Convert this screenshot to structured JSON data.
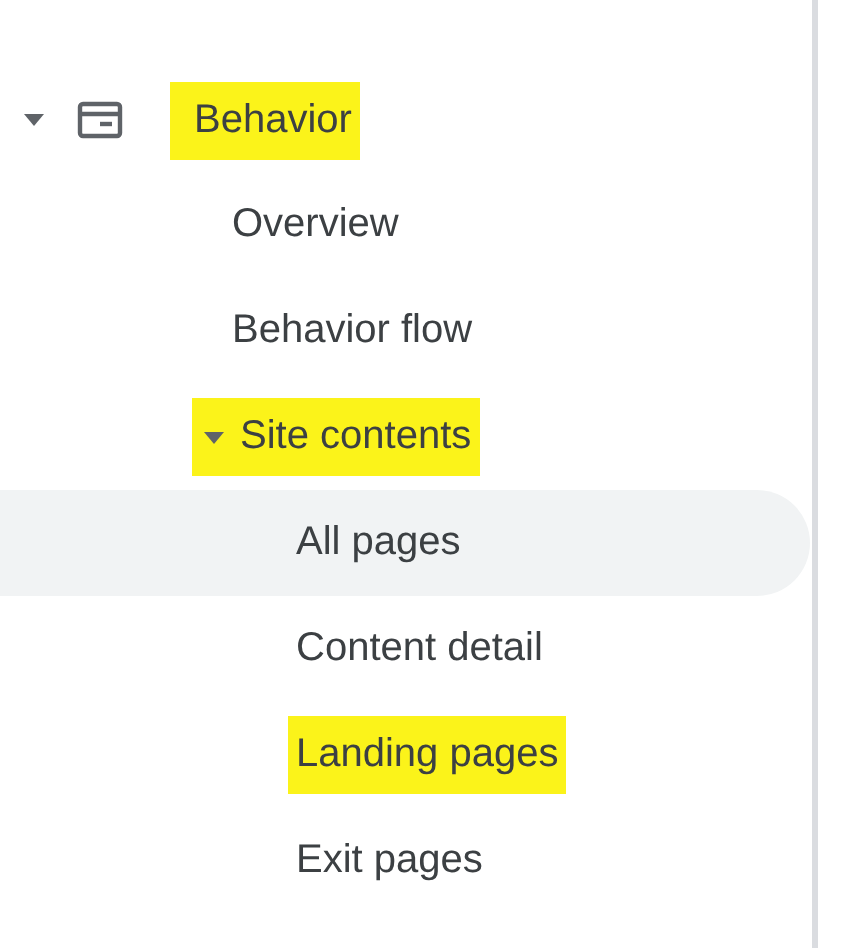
{
  "nav": [
    {
      "label": "Behavior",
      "expanded": true,
      "highlighted": true,
      "children": [
        {
          "label": "Overview",
          "selected": false,
          "highlighted": false
        },
        {
          "label": "Behavior flow",
          "selected": false,
          "highlighted": false
        },
        {
          "label": "Site contents",
          "expanded": true,
          "highlighted": true,
          "children": [
            {
              "label": "All pages",
              "selected": true,
              "highlighted": false
            },
            {
              "label": "Content detail",
              "selected": false,
              "highlighted": false
            },
            {
              "label": "Landing pages",
              "selected": false,
              "highlighted": true
            },
            {
              "label": "Exit pages",
              "selected": false,
              "highlighted": false
            }
          ]
        }
      ]
    }
  ]
}
